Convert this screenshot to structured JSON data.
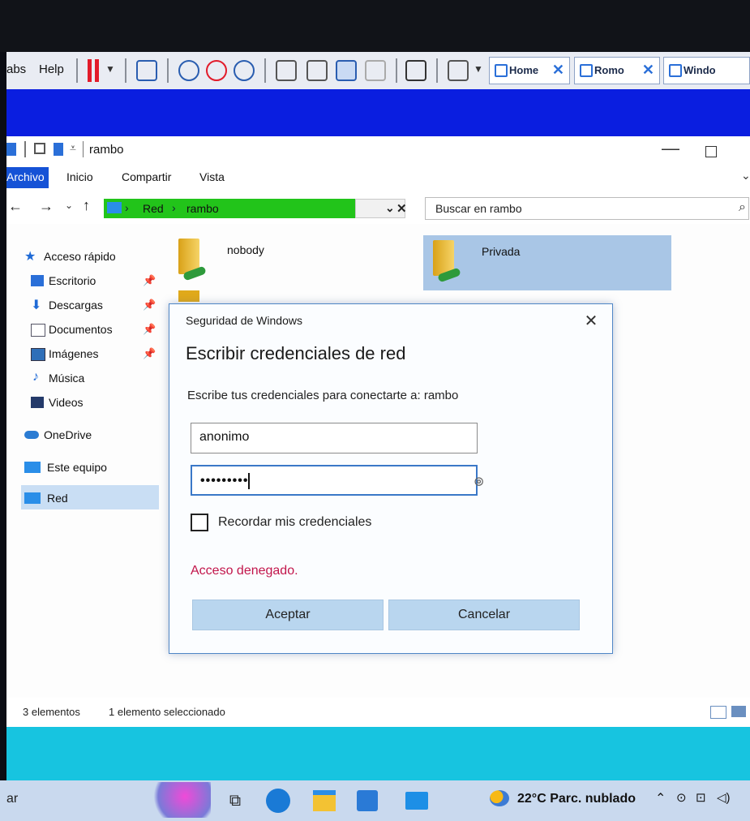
{
  "toolbar": {
    "tabs_fragment": "abs",
    "help": "Help",
    "tab_items": [
      {
        "label": "Home"
      },
      {
        "label": "Romo"
      },
      {
        "label": "Windo"
      }
    ]
  },
  "explorer": {
    "title": "rambo",
    "ribbon_tabs": [
      "Archivo",
      "Inicio",
      "Compartir",
      "Vista"
    ],
    "address": {
      "crumb1": "Red",
      "crumb2": "rambo"
    },
    "search_placeholder": "Buscar en rambo",
    "sidebar": [
      {
        "label": "Acceso rápido",
        "icon": "star-icon"
      },
      {
        "label": "Escritorio",
        "icon": "desktop-icon",
        "pinned": true
      },
      {
        "label": "Descargas",
        "icon": "download-icon",
        "pinned": true
      },
      {
        "label": "Documentos",
        "icon": "documents-icon",
        "pinned": true
      },
      {
        "label": "Imágenes",
        "icon": "images-icon",
        "pinned": true
      },
      {
        "label": "Música",
        "icon": "music-icon"
      },
      {
        "label": "Videos",
        "icon": "videos-icon"
      },
      {
        "label": "OneDrive",
        "icon": "cloud-icon"
      },
      {
        "label": "Este equipo",
        "icon": "computer-icon"
      },
      {
        "label": "Red",
        "icon": "network-icon"
      }
    ],
    "files": [
      {
        "name": "nobody"
      },
      {
        "name": "Privada"
      }
    ],
    "status": {
      "count": "3 elementos",
      "selected": "1 elemento seleccionado"
    }
  },
  "dialog": {
    "title": "Seguridad de Windows",
    "close": "✕",
    "heading": "Escribir credenciales de red",
    "description": "Escribe tus credenciales para conectarte a: rambo",
    "username": "anonimo",
    "password_mask": "•••••••••",
    "remember_label": "Recordar mis credenciales",
    "error": "Acceso denegado.",
    "ok": "Aceptar",
    "cancel": "Cancelar"
  },
  "taskbar": {
    "search_fragment": "ar",
    "weather": "22°C  Parc. nublado"
  },
  "colors": {
    "address_bar": "#22c41a",
    "error": "#c2154b",
    "dialog_button": "#b9d6ef",
    "selection": "#a9c6e6"
  }
}
